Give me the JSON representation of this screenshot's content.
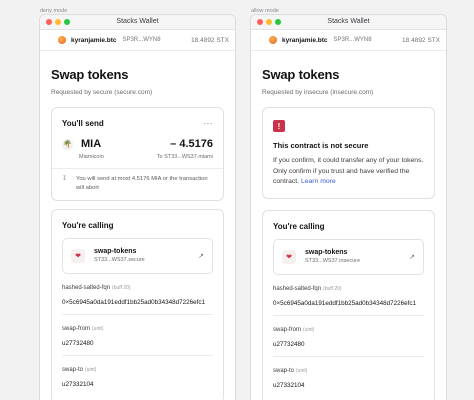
{
  "left": {
    "mode_label": "deny mode",
    "window_title": "Stacks Wallet",
    "account": {
      "name": "kyranjamie.btc",
      "address": "SP3R...WYN8",
      "balance": "18.4892 STX"
    },
    "page_title": "Swap tokens",
    "requested_by": "Requested by secure (secure.com)",
    "send": {
      "label": "You'll send",
      "more": "···",
      "symbol": "MIA",
      "amount": "– 4.5176",
      "token_name": "Miamicoin",
      "to": "To ST33...WS37.miami",
      "note": "You will send at most 4.5176 MIA or the transaction will abort"
    },
    "calling": {
      "label": "You're calling",
      "contract_name": "swap-tokens",
      "contract_id": "ST33...WS37.secure"
    },
    "args": [
      {
        "name": "hashed-salted-fqn",
        "type": "(buff 20)",
        "value": "0×5c6945a0da191eddf1bb25ad0b34348d7226efc1"
      },
      {
        "name": "swap-from",
        "type": "(uint)",
        "value": "u27732480"
      },
      {
        "name": "swap-to",
        "type": "(uint)",
        "value": "u27332104"
      }
    ]
  },
  "right": {
    "mode_label": "allow mode",
    "window_title": "Stacks Wallet",
    "account": {
      "name": "kyranjamie.btc",
      "address": "SP3R...WYN8",
      "balance": "18.4892 STX"
    },
    "page_title": "Swap tokens",
    "requested_by": "Requested by insecure (insecure.com)",
    "alert": {
      "title": "This contract is not secure",
      "body": "If you confirm, it could transfer any of your tokens. Only confirm if you trust and have verified the contract.",
      "link": "Learn more"
    },
    "calling": {
      "label": "You're calling",
      "contract_name": "swap-tokens",
      "contract_id": "ST33...WS37.insecure"
    },
    "args": [
      {
        "name": "hashed-salted-fqn",
        "type": "(buff 20)",
        "value": "0×5c6945a0da191eddf1bb25ad0b34348d7226efc1"
      },
      {
        "name": "swap-from",
        "type": "(uint)",
        "value": "u27732480"
      },
      {
        "name": "swap-to",
        "type": "(uint)",
        "value": "u27332104"
      }
    ]
  }
}
